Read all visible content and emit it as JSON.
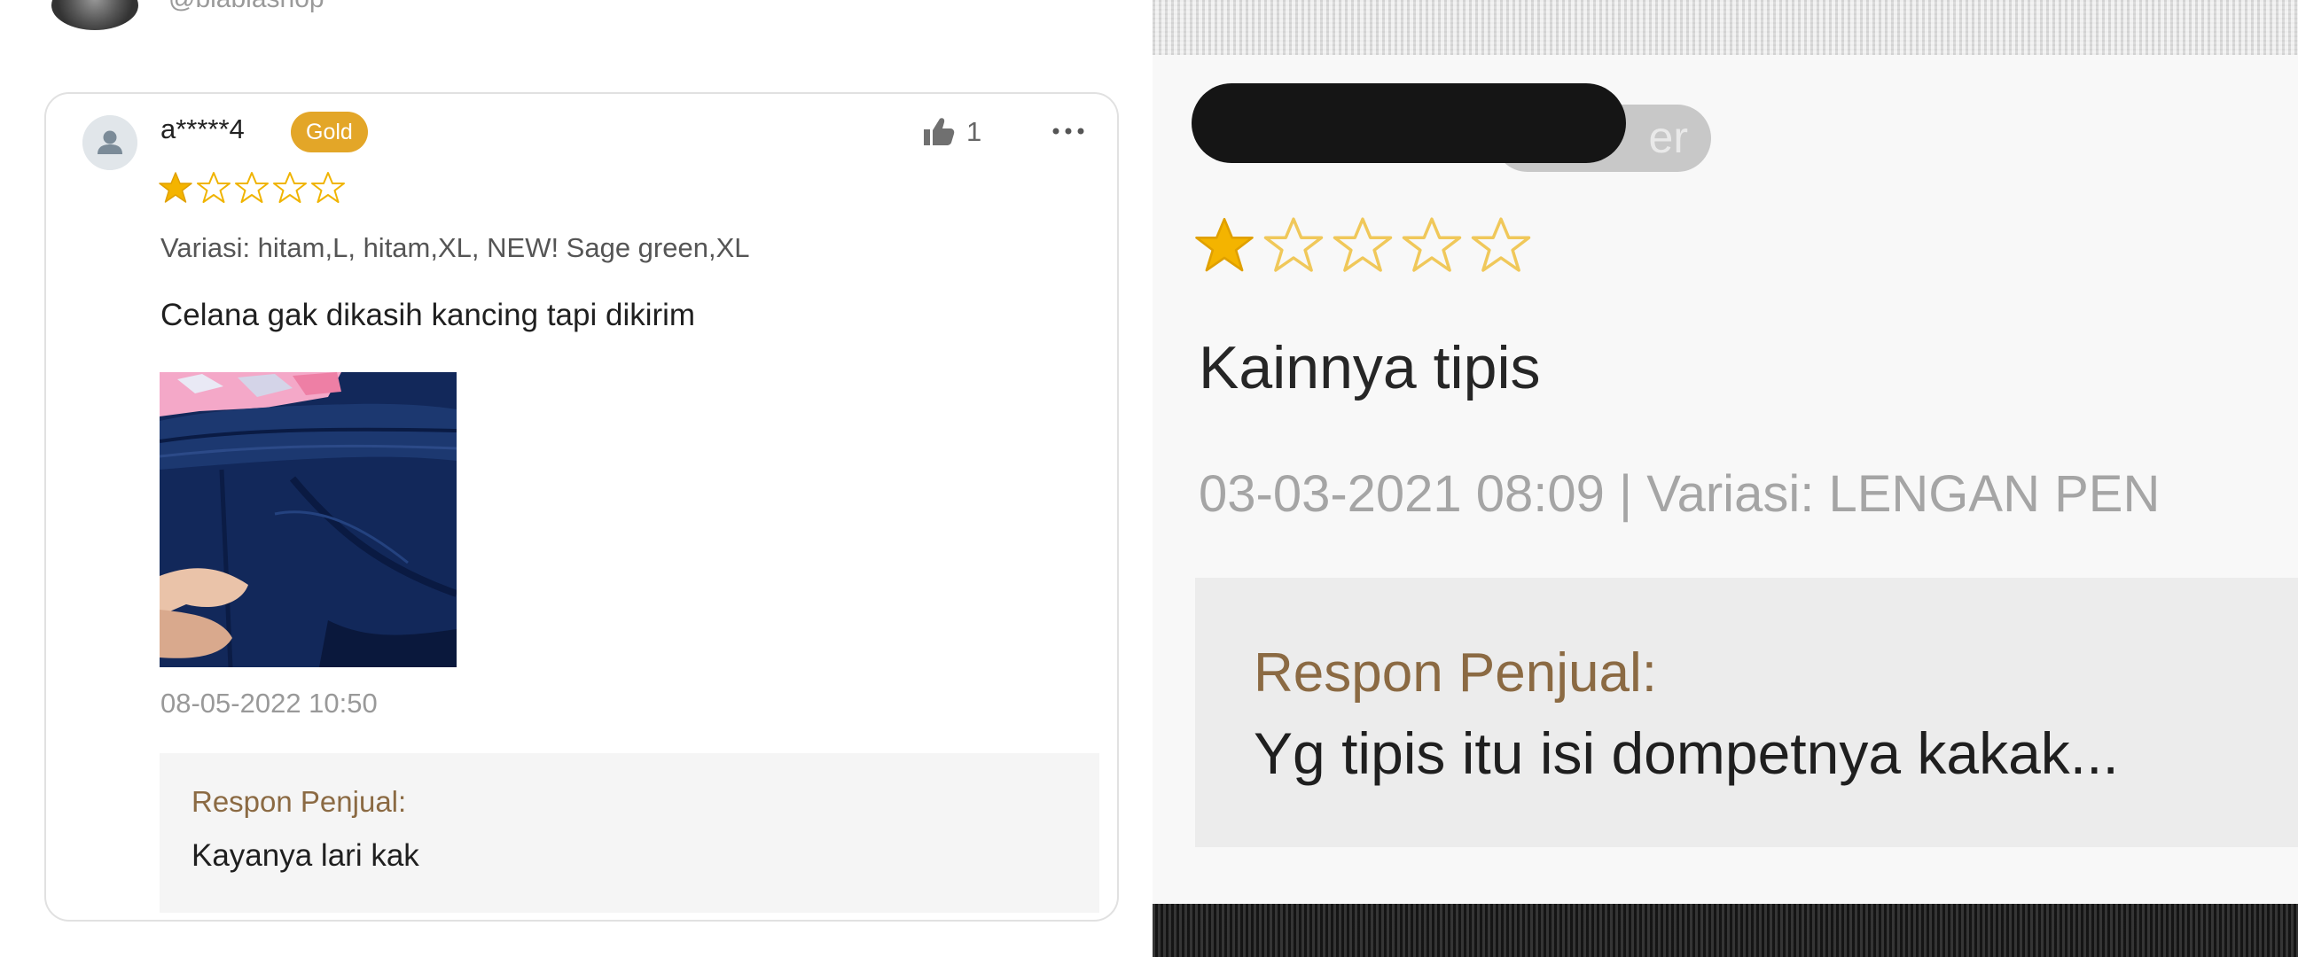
{
  "left_review": {
    "header_partial": {
      "handle": "@blablashop"
    },
    "user": {
      "name": "a*****4",
      "tier": "Gold",
      "icon": "user-placeholder-icon"
    },
    "likes": {
      "count": "1",
      "icon": "thumbs-up-icon"
    },
    "more_icon": "more-horizontal-icon",
    "rating": {
      "value": 1,
      "max": 5
    },
    "variation": "Variasi: hitam,L, hitam,XL, NEW! Sage green,XL",
    "comment": "Celana gak dikasih kancing tapi dikirim",
    "photo_icon": "product-photo-navy-pants",
    "timestamp": "08-05-2022 10:50",
    "seller_response": {
      "label": "Respon Penjual:",
      "text": "Kayanya lari kak"
    }
  },
  "right_review": {
    "badge_partial_text": "er",
    "rating": {
      "value": 1,
      "max": 5
    },
    "comment": "Kainnya tipis",
    "meta": "03-03-2021 08:09 | Variasi: LENGAN PEN",
    "seller_response": {
      "label": "Respon Penjual:",
      "text": "Yg tipis itu isi dompetnya kakak..."
    }
  },
  "colors": {
    "star_filled": "#f4b400",
    "star_outline": "#f0c85a",
    "gold_badge": "#e3a628",
    "seller_label": "#8b6a43",
    "seller_box": "#f5f5f5"
  }
}
